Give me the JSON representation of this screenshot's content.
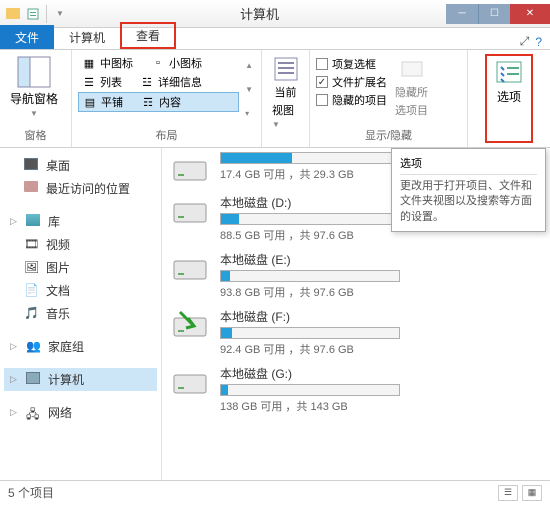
{
  "window": {
    "title": "计算机"
  },
  "tabs": {
    "file": "文件",
    "computer": "计算机",
    "view": "查看"
  },
  "ribbon": {
    "groups": {
      "pane": "窗格",
      "layout": "布局",
      "showhide": "显示/隐藏"
    },
    "nav_pane": "导航窗格",
    "layout_opts": {
      "medium_icons": "中图标",
      "small_icons": "小图标",
      "list": "列表",
      "details": "详细信息",
      "tiles": "平铺",
      "content": "内容"
    },
    "current_view": {
      "l1": "当前",
      "l2": "视图"
    },
    "checks": {
      "item_checkboxes": "项复选框",
      "file_ext": "文件扩展名",
      "hidden_items": "隐藏的项目"
    },
    "check_states": {
      "item_checkboxes": false,
      "file_ext": true,
      "hidden_items": false
    },
    "hide_selected": {
      "l1": "隐藏所",
      "l2": "选项目"
    },
    "options": "选项"
  },
  "tooltip": {
    "title": "选项",
    "desc": "更改用于打开项目、文件和文件夹视图以及搜索等方面的设置。"
  },
  "sidebar": {
    "desktop": "桌面",
    "recent": "最近访问的位置",
    "libraries": "库",
    "videos": "视频",
    "pictures": "图片",
    "documents": "文档",
    "music": "音乐",
    "homegroup": "家庭组",
    "computer": "计算机",
    "network": "网络"
  },
  "drives": [
    {
      "name": "",
      "fill": 40,
      "info": "17.4 GB 可用 ，共 29.3 GB"
    },
    {
      "name": "本地磁盘 (D:)",
      "fill": 10,
      "info": "88.5 GB 可用 ，共 97.6 GB"
    },
    {
      "name": "本地磁盘 (E:)",
      "fill": 5,
      "info": "93.8 GB 可用 ，共 97.6 GB"
    },
    {
      "name": "本地磁盘 (F:)",
      "fill": 6,
      "info": "92.4 GB 可用 ，共 97.6 GB",
      "arrow": true
    },
    {
      "name": "本地磁盘 (G:)",
      "fill": 4,
      "info": "138 GB 可用 ，共 143 GB"
    }
  ],
  "statusbar": {
    "count": "5 个项目"
  }
}
